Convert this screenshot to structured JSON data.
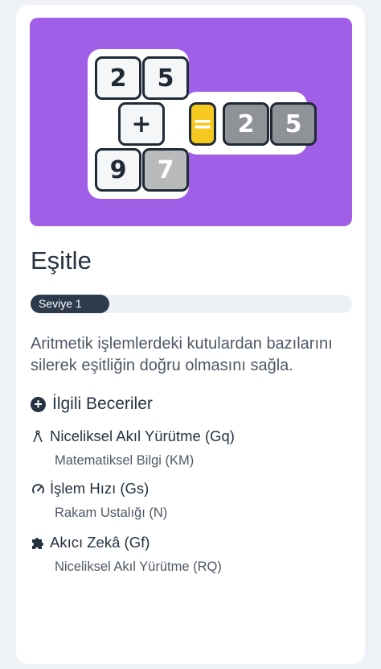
{
  "puzzle": {
    "tiles": {
      "r1c1": "2",
      "r1c2": "5",
      "op": "+",
      "r3c1": "9",
      "r3c2": "7",
      "equals": "=",
      "res1": "2",
      "res2": "5"
    }
  },
  "game": {
    "title": "Eşitle",
    "level_label": "Seviye 1",
    "description": "Aritmetik işlemlerdeki kutulardan bazılarını silerek eşitliğin doğru olmasını sağla."
  },
  "related": {
    "header": "İlgili Beceriler",
    "skills": [
      {
        "icon": "compass-icon",
        "title": "Niceliksel Akıl Yürütme (Gq)",
        "sub": "Matematiksel Bilgi (KM)"
      },
      {
        "icon": "speedometer-icon",
        "title": "İşlem Hızı (Gs)",
        "sub": "Rakam Ustalığı (N)"
      },
      {
        "icon": "puzzle-icon",
        "title": "Akıcı Zekâ (Gf)",
        "sub": "Niceliksel Akıl Yürütme (RQ)"
      }
    ]
  },
  "colors": {
    "banner": "#a05fe6",
    "text_dark": "#253341",
    "tile_gray": "#8f9296",
    "equals_yellow": "#f7c820"
  }
}
